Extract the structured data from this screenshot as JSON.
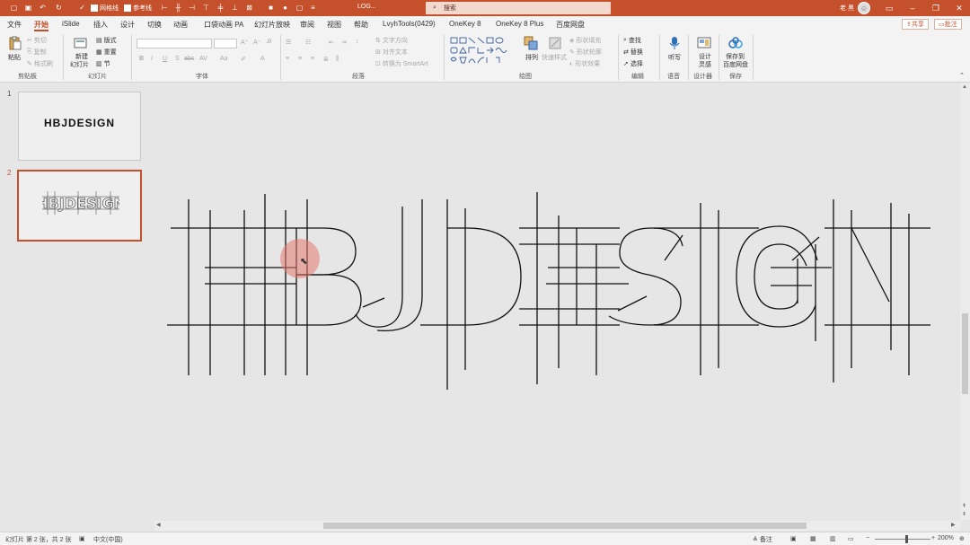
{
  "titlebar": {
    "doc_title": "LOG...",
    "gridlines_label": "网格线",
    "guides_label": "参考线",
    "search_placeholder": "搜索",
    "user_name": "老 黑",
    "bg_color": "#c4512b"
  },
  "menu": {
    "tabs": [
      "文件",
      "开始",
      "iSlide",
      "插入",
      "设计",
      "切换",
      "动画",
      "口袋动画 PA",
      "幻灯片放映",
      "审阅",
      "视图",
      "帮助",
      "LvyhTools(0429)",
      "OneKey 8",
      "OneKey 8 Plus",
      "百度网盘"
    ],
    "active_tab": "开始",
    "share_label": "共享",
    "comment_label": "批注"
  },
  "ribbon": {
    "clipboard": {
      "paste": "粘贴",
      "cut": "剪切",
      "copy": "复制",
      "format_painter": "格式刷",
      "label": "剪贴板"
    },
    "slides": {
      "new_slide": "新建",
      "new_slide2": "幻灯片",
      "layout": "版式",
      "reset": "重置",
      "section": "节",
      "label": "幻灯片"
    },
    "font": {
      "label": "字体",
      "bold": "B",
      "italic": "I",
      "underline": "U",
      "shadow": "S",
      "strike": "abc"
    },
    "paragraph": {
      "label": "段落",
      "text_direction": "文字方向",
      "align_text": "对齐文本",
      "smartart": "转换为 SmartArt"
    },
    "drawing": {
      "label": "绘图",
      "arrange": "排列",
      "quick_styles": "快速样式",
      "shape_fill": "形状填充",
      "shape_outline": "形状轮廓",
      "shape_effects": "形状效果"
    },
    "editing": {
      "label": "编辑",
      "find": "查找",
      "replace": "替换",
      "select": "选择"
    },
    "voice": {
      "label": "语音",
      "dictate": "听写"
    },
    "designer": {
      "label": "设计器",
      "design_ideas": "设计",
      "design_ideas2": "灵感"
    },
    "save": {
      "label": "保存",
      "save_to": "保存到",
      "baidu": "百度网盘"
    }
  },
  "slides_panel": {
    "slides": [
      {
        "number": "1",
        "title": "HBJDESIGN"
      },
      {
        "number": "2",
        "title": "HBJDESIGN"
      }
    ]
  },
  "main_slide": {
    "text": "HBJDESIGN",
    "stroke_color": "#111111"
  },
  "statusbar": {
    "slide_info": "幻灯片 第 2 张，共 2 张",
    "language": "中文(中国)",
    "notes": "备注",
    "zoom": "200%"
  },
  "icons": [
    "save-icon",
    "undo-icon",
    "redo-icon",
    "paste-icon",
    "new-slide-icon",
    "search-icon",
    "mic-icon",
    "design-ideas-icon",
    "baidu-cloud-icon"
  ]
}
